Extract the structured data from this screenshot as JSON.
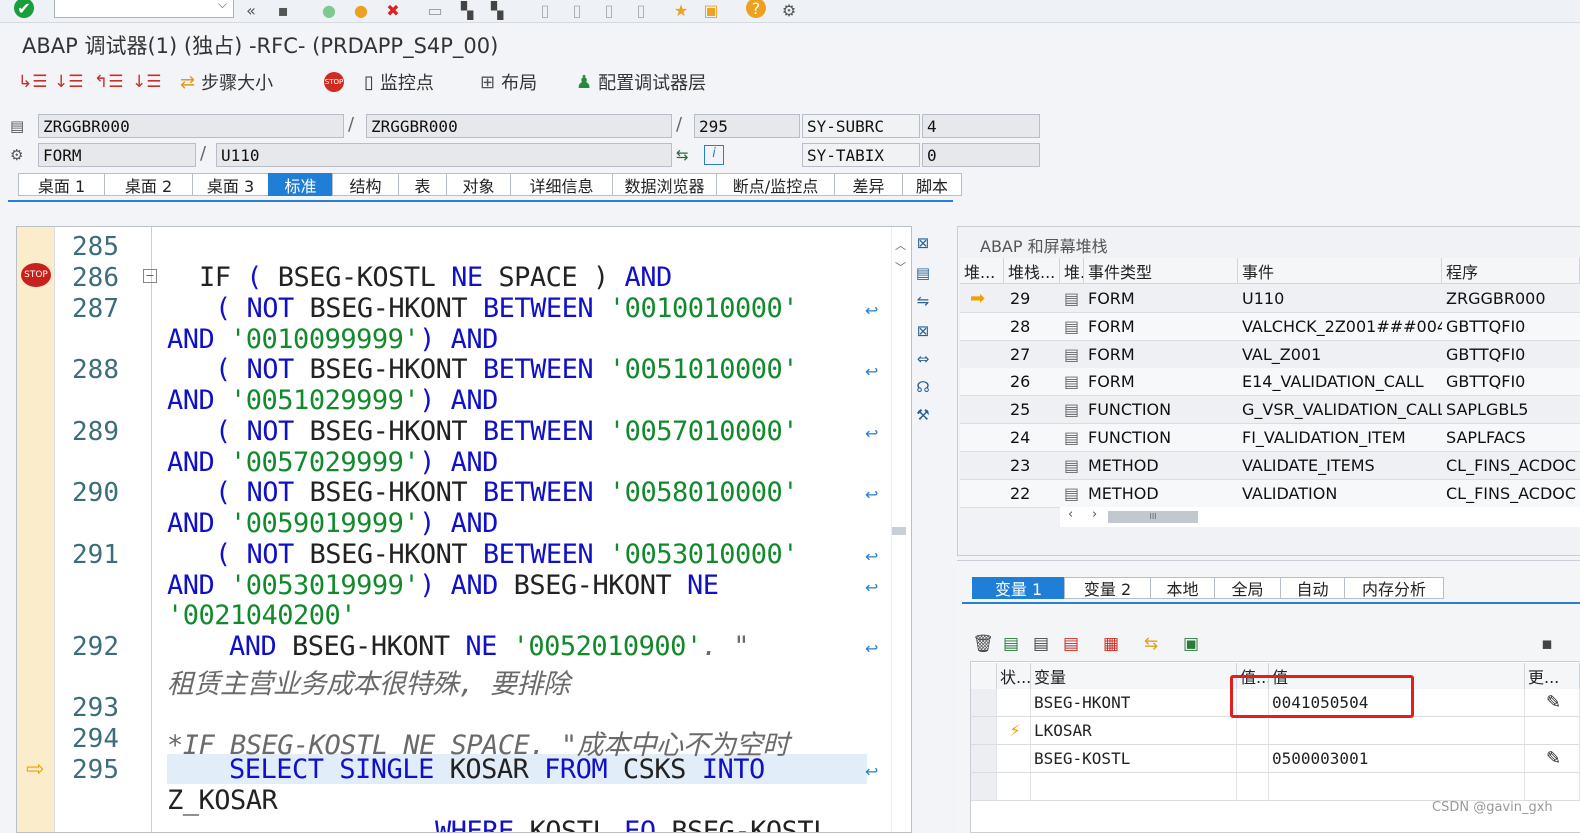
{
  "window": {
    "title": "ABAP 调试器(1)  (独占) -RFC- (PRDAPP_S4P_00)"
  },
  "toolbar": {
    "step_size_label": "步骤大小",
    "watchpoint_label": "监控点",
    "layout_label": "布局",
    "config_label": "配置调试器层"
  },
  "header": {
    "program1": "ZRGGBR000",
    "program2": "ZRGGBR000",
    "line": "295",
    "subrc_label": "SY-SUBRC",
    "subrc_value": "4",
    "event_type": "FORM",
    "event_name": "U110",
    "tabix_label": "SY-TABIX",
    "tabix_value": "0"
  },
  "tabs": [
    "桌面 1",
    "桌面 2",
    "桌面 3",
    "标准",
    "结构",
    "表",
    "对象",
    "详细信息",
    "数据浏览器",
    "断点/监控点",
    "差异",
    "脚本"
  ],
  "active_tab": "标准",
  "code": {
    "line_numbers": [
      "285",
      "286",
      "287",
      "288",
      "289",
      "290",
      "291",
      "292",
      "293",
      "294",
      "295"
    ],
    "l286": {
      "kw_if": "IF",
      "p1": "( ",
      "f1": "BSEG-KOSTL ",
      "ne": "NE",
      "sp": " SPACE ) ",
      "and": "AND"
    },
    "l287a": {
      "p": "( ",
      "not": "NOT",
      "f": " BSEG-HKONT ",
      "between": "BETWEEN",
      "s": " '0010010000'"
    },
    "l287b": {
      "and1": "AND",
      "s": " '0010099999'",
      "p": ") ",
      "and2": "AND"
    },
    "l288a": {
      "p": "( ",
      "not": "NOT",
      "f": " BSEG-HKONT ",
      "between": "BETWEEN",
      "s": " '0051010000'"
    },
    "l288b": {
      "and1": "AND",
      "s": " '0051029999'",
      "p": ") ",
      "and2": "AND"
    },
    "l289a": {
      "p": "( ",
      "not": "NOT",
      "f": " BSEG-HKONT ",
      "between": "BETWEEN",
      "s": " '0057010000'"
    },
    "l289b": {
      "and1": "AND",
      "s": " '0057029999'",
      "p": ") ",
      "and2": "AND"
    },
    "l290a": {
      "p": "( ",
      "not": "NOT",
      "f": " BSEG-HKONT ",
      "between": "BETWEEN",
      "s": " '0058010000'"
    },
    "l290b": {
      "and1": "AND",
      "s": " '0059019999'",
      "p": ") ",
      "and2": "AND"
    },
    "l291a": {
      "p": "( ",
      "not": "NOT",
      "f": " BSEG-HKONT ",
      "between": "BETWEEN",
      "s": " '0053010000'"
    },
    "l291b": {
      "and1": "AND",
      "s": " '0053019999'",
      "p": ") ",
      "and2": "AND",
      "f": " BSEG-HKONT ",
      "ne": "NE"
    },
    "l291c": {
      "s": "'0021040200'"
    },
    "l292": {
      "and": "AND",
      "f": " BSEG-HKONT ",
      "ne": "NE",
      "s": " '0052010900'",
      "rest": ". \""
    },
    "l292c": "租赁主营业务成本很特殊, 要排除",
    "l294": "*IF BSEG-KOSTL NE SPACE. \"成本中心不为空时",
    "l295": {
      "select": "SELECT SINGLE",
      "f": " KOSAR ",
      "from": "FROM",
      "t": " CSKS ",
      "into": "INTO"
    },
    "l295b": "Z_KOSAR",
    "l296": {
      "where": "WHERE",
      "f": " KOSTL ",
      "eq": "EQ",
      "t": " BSEG-KOSTL"
    }
  },
  "stack": {
    "title": "ABAP 和屏幕堆栈",
    "headers": [
      "堆...",
      "堆栈...",
      "堆.",
      "事件类型",
      "事件",
      "程序"
    ],
    "rows": [
      {
        "level": "29",
        "type": "FORM",
        "event": "U110",
        "program": "ZRGGBR000",
        "current": true
      },
      {
        "level": "28",
        "type": "FORM",
        "event": "VALCHCK_2Z001###004",
        "program": "GBTTQFI0",
        "current": false
      },
      {
        "level": "27",
        "type": "FORM",
        "event": "VAL_Z001",
        "program": "GBTTQFI0",
        "current": false
      },
      {
        "level": "26",
        "type": "FORM",
        "event": "E14_VALIDATION_CALL",
        "program": "GBTTQFI0",
        "current": false
      },
      {
        "level": "25",
        "type": "FUNCTION",
        "event": "G_VSR_VALIDATION_CALL",
        "program": "SAPLGBL5",
        "current": false
      },
      {
        "level": "24",
        "type": "FUNCTION",
        "event": "FI_VALIDATION_ITEM",
        "program": "SAPLFACS",
        "current": false
      },
      {
        "level": "23",
        "type": "METHOD",
        "event": "VALIDATE_ITEMS",
        "program": "CL_FINS_ACDOC",
        "current": false
      },
      {
        "level": "22",
        "type": "METHOD",
        "event": "VALIDATION",
        "program": "CL_FINS_ACDOC",
        "current": false
      }
    ],
    "scroll_label": "III"
  },
  "vartabs": [
    "变量 1",
    "变量 2",
    "本地",
    "全局",
    "自动",
    "内存分析"
  ],
  "active_vartab": "变量 1",
  "variables": {
    "headers": [
      "状...",
      "变量",
      "值...",
      "值",
      "更..."
    ],
    "rows": [
      {
        "name": "BSEG-HKONT",
        "value": "0041050504",
        "flag": "",
        "editable": true
      },
      {
        "name": "LKOSAR",
        "value": "",
        "flag": "⚡",
        "editable": false
      },
      {
        "name": "BSEG-KOSTL",
        "value": "0500003001",
        "flag": "",
        "editable": true
      }
    ]
  },
  "watermark": "CSDN @gavin_gxh",
  "colors": {
    "accent": "#1f7fd6",
    "keyword": "#1010c8",
    "string": "#128a2c",
    "highlight_box": "#e0201c"
  }
}
